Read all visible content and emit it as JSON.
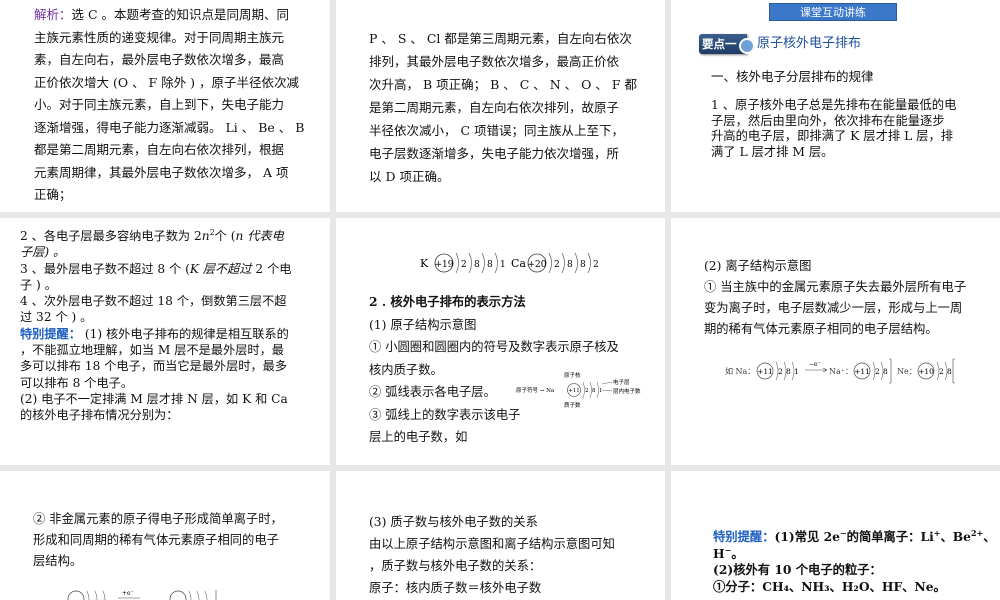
{
  "p1": {
    "lines": [
      [
        "解析：",
        "选 C 。本题考查的知识点是同周期、同"
      ],
      [
        "",
        "主族元素性质的递变规律。对于同周期主族元"
      ],
      [
        "",
        "素，自左向右，最外层电子数依次增多，最高"
      ],
      [
        "",
        "正价依次增大 (O 、 F 除外 ) ，原子半径依次减"
      ],
      [
        "",
        "小。对于同主族元素，自上到下，失电子能力"
      ],
      [
        "",
        "逐渐增强，得电子能力逐渐减弱。 Li 、 Be 、 B"
      ],
      [
        "",
        "都是第二周期元素，自左向右依次排列，根据"
      ],
      [
        "",
        "元素周期律，其最外层电子数依次增多， A 项"
      ],
      [
        "",
        "正确；"
      ]
    ]
  },
  "p2": {
    "lines": [
      "P 、 S 、 Cl 都是第三周期元素，自左向右依次",
      "排列，其最外层电子数依次增多，最高正价依",
      "次升高， B 项正确； B 、 C 、 N 、 O 、 F 都",
      "是第二周期元素，自左向右依次排列，故原子",
      "半径依次减小， C 项错误；同主族从上至下，",
      "电子层数逐渐增多，失电子能力依次增强，所",
      "以 D 项正确。"
    ]
  },
  "p3": {
    "badge": "课堂互动讲练",
    "key_tag": "要点一",
    "key_title": "原子核外电子排布",
    "subtitle": "一、核外电子分层排布的规律",
    "para": [
      "1 、原子核外电子总是先排布在能量最低的电",
      "子层，然后由里向外，依次排布在能量逐步",
      "升高的电子层，即排满了 K 层才排 L 层，排",
      "满了 L 层才排 M 层。"
    ]
  },
  "p4": {
    "l1a": "2 、各电子层最多容纳电子数为 2",
    "l1b": "n",
    "l1sup": "2",
    "l1c": "个 (",
    "l1d": "n 代表电",
    "l2": "子层) 。",
    "l3a": "3 、最外层电子数不超过 8 个 (",
    "l3b": "K 层不超过",
    "l3c": " 2 个电",
    "l4": "子 ) 。",
    "l5": "4 、次外层电子数不超过 18 个，倒数第三层不超",
    "l6": "过 32 个 ) 。",
    "tip_label": "特别提醒：",
    "tip": [
      "(1) 核外电子排布的规律是相互联系的",
      "，不能孤立地理解，如当 M 层不是最外层时，最",
      "多可以排布 18 个电子，而当它是最外层时，最多",
      "可以排布 8 个电子。"
    ],
    "p2": [
      "(2) 电子不一定排满 M 层才排 N 层，如 K 和 Ca",
      "的核外电子排布情况分别为："
    ]
  },
  "p5": {
    "k_symbol": "K",
    "k_nucleus": "+19",
    "k_shells": [
      "2",
      "8",
      "8",
      "1"
    ],
    "ca_symbol": "Ca",
    "ca_nucleus": "+20",
    "ca_shells": [
      "2",
      "8",
      "8",
      "2"
    ],
    "heading": "2 . 核外电子排布的表示方法",
    "sub1": "(1) 原子结构示意图",
    "items": [
      "① 小圆圈和圆圈内的符号及数字表示原子核及",
      "核内质子数。",
      "② 弧线表示各电子层。",
      "③ 弧线上的数字表示该电子",
      "层上的电子数，如"
    ],
    "dia_top": "原子核",
    "dia_bottom": "质子数",
    "dia_left": "原子符号 → Na",
    "dia_r1": "电子层",
    "dia_r2": "层内电子数",
    "dia_nucleus": "+11",
    "dia_shells": [
      "2",
      "8",
      "1"
    ]
  },
  "p6": {
    "heading": "(2) 离子结构示意图",
    "lines": [
      "① 当主族中的金属元素原子失去最外层所有电子",
      "变为离子时，电子层数减少一层，形成与上一周",
      "期的稀有气体元素原子相同的电子层结构。"
    ],
    "ex_prefix": "如 Na：",
    "ex_nucleus": "+11",
    "ex_shells": [
      "2",
      "8",
      "1"
    ],
    "ex_arrow": "−e⁻",
    "ex_ion": "Na⁺：",
    "ex_ion_shells": [
      "2",
      "8"
    ],
    "ex_ne": "Ne：",
    "ex_ne_nucleus": "+10",
    "ex_ne_shells": [
      "2",
      "8"
    ]
  },
  "p7": {
    "lines": [
      "② 非金属元素的原子得电子形成简单离子时，",
      "形成和同周期的稀有气体元素原子相同的电子",
      "层结构。"
    ],
    "ex_arrow": "+e⁻"
  },
  "p8": {
    "heading": "(3) 质子数与核外电子数的关系",
    "lines": [
      "由以上原子结构示意图和离子结构示意图可知",
      "，质子数与核外电子数的关系：",
      "原子：核内质子数＝核外电子数"
    ]
  },
  "p9": {
    "tip_label": "特别提醒：",
    "l1a": "(1)常见 2e",
    "l1b": "的简单离子：Li",
    "l1c": "、Be",
    "l1d": "、",
    "l2": "H",
    "l2b": "。",
    "l3": "(2)核外有 10 个电子的粒子：",
    "l4": "①分子：CH₄、NH₃、H₂O、HF、Ne。"
  }
}
